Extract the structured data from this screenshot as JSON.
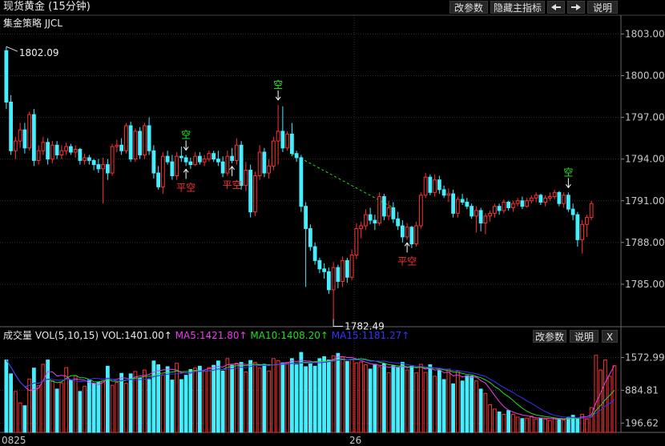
{
  "window": {
    "title": "现货黄金 (15分钟)",
    "strategy": "集金策略 JJCL"
  },
  "toolbar": {
    "params": "改参数",
    "hide_indicator": "隐藏主指标",
    "left_arrow": "left-arrow-icon",
    "right_arrow": "right-arrow-icon",
    "help": "说明"
  },
  "vol_toolbar": {
    "params": "改参数",
    "help": "说明",
    "close": "X"
  },
  "colors": {
    "up": "#ff3030",
    "down": "#44eeff",
    "ma5": "#ee3cee",
    "ma10": "#22dd22",
    "ma15": "#3333ff",
    "sell": "#22ee22",
    "close": "#ff3030"
  },
  "chart_data": [
    {
      "type": "candlestick",
      "title": "现货黄金 (15分钟)",
      "ylim": [
        1782.0,
        1803.6
      ],
      "y_ticks": [
        "1803.00",
        "1800.00",
        "1797.00",
        "1794.00",
        "1791.00",
        "1788.00",
        "1785.00"
      ],
      "x_ticks": [
        {
          "index": 0,
          "label": "0825"
        },
        {
          "index": 76,
          "label": "26"
        }
      ],
      "candles": [
        [
          1801.8,
          1802.09,
          1797.6,
          1798.1
        ],
        [
          1798.1,
          1798.6,
          1794.3,
          1794.6
        ],
        [
          1794.6,
          1795.6,
          1794.0,
          1795.3
        ],
        [
          1795.3,
          1796.6,
          1794.8,
          1796.1
        ],
        [
          1796.1,
          1796.6,
          1794.4,
          1794.8
        ],
        [
          1794.8,
          1797.4,
          1794.6,
          1797.2
        ],
        [
          1797.2,
          1797.6,
          1793.5,
          1793.9
        ],
        [
          1793.9,
          1795.0,
          1793.6,
          1794.6
        ],
        [
          1794.6,
          1795.6,
          1794.3,
          1795.2
        ],
        [
          1795.2,
          1795.5,
          1793.6,
          1794.0
        ],
        [
          1794.0,
          1795.3,
          1793.7,
          1795.0
        ],
        [
          1795.0,
          1795.3,
          1794.0,
          1794.3
        ],
        [
          1794.3,
          1795.0,
          1794.0,
          1794.6
        ],
        [
          1794.6,
          1795.2,
          1794.3,
          1794.9
        ],
        [
          1794.9,
          1795.1,
          1794.3,
          1794.5
        ],
        [
          1794.5,
          1795.0,
          1794.1,
          1794.7
        ],
        [
          1794.7,
          1794.8,
          1793.6,
          1793.9
        ],
        [
          1793.9,
          1794.4,
          1793.6,
          1794.1
        ],
        [
          1794.1,
          1794.3,
          1793.6,
          1793.9
        ],
        [
          1793.9,
          1794.0,
          1793.2,
          1793.6
        ],
        [
          1793.6,
          1794.0,
          1793.0,
          1793.3
        ],
        [
          1793.3,
          1794.1,
          1790.8,
          1793.6
        ],
        [
          1793.6,
          1794.0,
          1792.5,
          1793.0
        ],
        [
          1793.0,
          1795.1,
          1792.8,
          1794.9
        ],
        [
          1794.9,
          1795.4,
          1794.5,
          1795.0
        ],
        [
          1795.0,
          1795.5,
          1794.3,
          1794.6
        ],
        [
          1794.6,
          1796.6,
          1794.4,
          1796.4
        ],
        [
          1796.4,
          1796.7,
          1793.8,
          1794.0
        ],
        [
          1794.0,
          1796.2,
          1793.8,
          1796.0
        ],
        [
          1796.0,
          1796.3,
          1794.0,
          1794.3
        ],
        [
          1794.3,
          1796.6,
          1794.0,
          1796.4
        ],
        [
          1796.4,
          1797.0,
          1794.3,
          1794.6
        ],
        [
          1794.6,
          1795.0,
          1792.6,
          1793.0
        ],
        [
          1793.0,
          1793.5,
          1791.8,
          1792.0
        ],
        [
          1792.0,
          1794.5,
          1791.5,
          1794.2
        ],
        [
          1794.2,
          1794.6,
          1793.6,
          1793.8
        ],
        [
          1793.8,
          1794.3,
          1792.5,
          1792.8
        ],
        [
          1792.8,
          1794.5,
          1792.5,
          1794.2
        ],
        [
          1794.2,
          1794.9,
          1793.8,
          1794.1
        ],
        [
          1794.1,
          1794.3,
          1793.5,
          1793.8
        ],
        [
          1793.8,
          1794.1,
          1793.3,
          1793.6
        ],
        [
          1793.6,
          1794.5,
          1793.5,
          1794.2
        ],
        [
          1794.2,
          1794.5,
          1793.6,
          1793.8
        ],
        [
          1793.8,
          1794.3,
          1793.5,
          1794.0
        ],
        [
          1794.0,
          1794.6,
          1793.8,
          1794.4
        ],
        [
          1794.4,
          1794.6,
          1793.8,
          1794.0
        ],
        [
          1794.0,
          1794.6,
          1793.5,
          1793.8
        ],
        [
          1793.8,
          1794.2,
          1792.7,
          1793.0
        ],
        [
          1793.0,
          1794.6,
          1792.8,
          1794.2
        ],
        [
          1794.2,
          1794.8,
          1793.7,
          1793.9
        ],
        [
          1793.9,
          1795.5,
          1793.6,
          1795.0
        ],
        [
          1795.0,
          1795.3,
          1791.8,
          1792.1
        ],
        [
          1792.1,
          1793.8,
          1791.7,
          1793.2
        ],
        [
          1793.2,
          1793.6,
          1789.8,
          1790.2
        ],
        [
          1790.2,
          1793.1,
          1789.9,
          1792.8
        ],
        [
          1792.8,
          1795.0,
          1792.5,
          1794.5
        ],
        [
          1794.5,
          1794.8,
          1792.7,
          1793.0
        ],
        [
          1793.0,
          1794.0,
          1792.6,
          1793.5
        ],
        [
          1793.5,
          1795.6,
          1793.2,
          1795.3
        ],
        [
          1795.3,
          1797.9,
          1793.6,
          1796.0
        ],
        [
          1796.0,
          1797.8,
          1794.5,
          1794.8
        ],
        [
          1794.8,
          1796.0,
          1794.6,
          1795.8
        ],
        [
          1795.8,
          1796.6,
          1794.2,
          1794.4
        ],
        [
          1794.4,
          1794.6,
          1793.8,
          1794.1
        ],
        [
          1794.1,
          1794.3,
          1790.2,
          1790.6
        ],
        [
          1790.6,
          1790.9,
          1784.8,
          1789.0
        ],
        [
          1789.0,
          1789.3,
          1787.4,
          1787.7
        ],
        [
          1787.7,
          1788.0,
          1786.4,
          1786.7
        ],
        [
          1786.7,
          1786.9,
          1785.8,
          1786.1
        ],
        [
          1786.1,
          1786.5,
          1785.4,
          1785.9
        ],
        [
          1785.9,
          1786.2,
          1784.3,
          1784.6
        ],
        [
          1784.6,
          1786.6,
          1782.49,
          1786.2
        ],
        [
          1786.2,
          1786.4,
          1784.7,
          1785.2
        ],
        [
          1785.2,
          1787.0,
          1784.8,
          1786.7
        ],
        [
          1786.7,
          1786.9,
          1785.1,
          1785.5
        ],
        [
          1785.5,
          1787.5,
          1785.3,
          1787.1
        ],
        [
          1787.1,
          1789.4,
          1786.8,
          1789.0
        ],
        [
          1789.0,
          1789.5,
          1788.3,
          1789.2
        ],
        [
          1789.2,
          1790.4,
          1788.9,
          1790.0
        ],
        [
          1790.0,
          1790.5,
          1789.3,
          1789.6
        ],
        [
          1789.6,
          1790.0,
          1788.9,
          1789.4
        ],
        [
          1789.4,
          1791.6,
          1789.2,
          1791.3
        ],
        [
          1791.3,
          1791.5,
          1789.6,
          1789.9
        ],
        [
          1789.9,
          1791.0,
          1789.6,
          1790.5
        ],
        [
          1790.5,
          1790.9,
          1789.4,
          1789.7
        ],
        [
          1789.7,
          1790.2,
          1788.9,
          1789.2
        ],
        [
          1789.2,
          1789.6,
          1788.0,
          1788.4
        ],
        [
          1788.4,
          1789.4,
          1788.2,
          1789.1
        ],
        [
          1789.1,
          1789.2,
          1787.6,
          1787.9
        ],
        [
          1787.9,
          1789.5,
          1787.7,
          1789.2
        ],
        [
          1789.2,
          1791.6,
          1789.0,
          1791.4
        ],
        [
          1791.4,
          1793.0,
          1791.2,
          1792.7
        ],
        [
          1792.7,
          1792.9,
          1791.4,
          1791.6
        ],
        [
          1791.6,
          1792.9,
          1791.3,
          1792.5
        ],
        [
          1792.5,
          1792.8,
          1791.5,
          1791.8
        ],
        [
          1791.8,
          1792.1,
          1791.2,
          1791.4
        ],
        [
          1791.4,
          1791.9,
          1790.9,
          1791.5
        ],
        [
          1791.5,
          1791.8,
          1789.8,
          1790.1
        ],
        [
          1790.1,
          1791.3,
          1789.8,
          1791.1
        ],
        [
          1791.1,
          1791.5,
          1790.7,
          1790.9
        ],
        [
          1790.9,
          1791.2,
          1790.4,
          1790.6
        ],
        [
          1790.6,
          1790.8,
          1789.7,
          1789.9
        ],
        [
          1789.9,
          1790.6,
          1788.7,
          1790.3
        ],
        [
          1790.3,
          1790.5,
          1788.8,
          1789.4
        ],
        [
          1789.4,
          1790.1,
          1788.6,
          1789.9
        ],
        [
          1789.9,
          1790.3,
          1789.5,
          1790.1
        ],
        [
          1790.1,
          1790.8,
          1789.8,
          1790.6
        ],
        [
          1790.6,
          1790.8,
          1790.0,
          1790.3
        ],
        [
          1790.3,
          1791.1,
          1790.1,
          1790.9
        ],
        [
          1790.9,
          1791.0,
          1790.3,
          1790.5
        ],
        [
          1790.5,
          1791.0,
          1790.2,
          1790.8
        ],
        [
          1790.8,
          1791.2,
          1790.6,
          1791.0
        ],
        [
          1791.0,
          1791.3,
          1790.4,
          1790.6
        ],
        [
          1790.6,
          1791.2,
          1790.5,
          1791.0
        ],
        [
          1791.0,
          1791.4,
          1790.8,
          1791.2
        ],
        [
          1791.2,
          1791.6,
          1790.9,
          1791.4
        ],
        [
          1791.4,
          1791.5,
          1790.7,
          1790.9
        ],
        [
          1790.9,
          1791.4,
          1790.6,
          1791.2
        ],
        [
          1791.2,
          1791.6,
          1791.0,
          1791.3
        ],
        [
          1791.3,
          1791.8,
          1791.1,
          1791.6
        ],
        [
          1791.6,
          1791.7,
          1790.6,
          1790.8
        ],
        [
          1790.8,
          1791.6,
          1790.5,
          1791.4
        ],
        [
          1791.4,
          1791.6,
          1790.2,
          1790.4
        ],
        [
          1790.4,
          1790.8,
          1789.6,
          1790.0
        ],
        [
          1790.0,
          1790.2,
          1787.7,
          1788.2
        ],
        [
          1788.2,
          1789.6,
          1787.2,
          1789.3
        ],
        [
          1789.3,
          1790.0,
          1788.4,
          1789.8
        ],
        [
          1789.8,
          1791.0,
          1789.6,
          1790.8
        ]
      ],
      "labels": [
        {
          "text": "1802.09",
          "kind": "high"
        },
        {
          "text": "1782.49",
          "kind": "low"
        }
      ],
      "signals": [
        {
          "index": 39,
          "text": "空",
          "kind": "sell"
        },
        {
          "index": 59,
          "text": "空",
          "kind": "sell"
        },
        {
          "index": 122,
          "text": "空",
          "kind": "sell"
        },
        {
          "index": 39,
          "text": "平空",
          "kind": "close"
        },
        {
          "index": 49,
          "text": "平空",
          "kind": "close"
        },
        {
          "index": 87,
          "text": "平空",
          "kind": "close"
        }
      ],
      "dashed_line": {
        "from": 62,
        "to": 84
      }
    },
    {
      "type": "bar",
      "title": "成交量 VOL(5,10,15)",
      "ylim": [
        0,
        1850
      ],
      "y_ticks": [
        "1572.99",
        "884.81",
        "196.62"
      ],
      "series": [
        {
          "name": "VOL",
          "last_label": "VOL:1401.00↑"
        },
        {
          "name": "MA5",
          "last_label": "MA5:1421.80↑"
        },
        {
          "name": "MA10",
          "last_label": "MA10:1408.20↑"
        },
        {
          "name": "MA15",
          "last_label": "MA15:1181.27↑"
        }
      ],
      "volumes": [
        1520,
        1230,
        860,
        620,
        560,
        1120,
        1350,
        980,
        1430,
        1520,
        1080,
        910,
        1040,
        1360,
        1100,
        1190,
        860,
        970,
        1110,
        1030,
        1050,
        1080,
        1390,
        990,
        1050,
        1240,
        1030,
        1230,
        1280,
        1140,
        1310,
        1110,
        1500,
        1420,
        1210,
        1380,
        1100,
        1450,
        1110,
        1200,
        1320,
        1350,
        1390,
        1290,
        1360,
        1410,
        1500,
        1290,
        1550,
        1410,
        1450,
        1470,
        1270,
        1510,
        1470,
        1350,
        1430,
        1290,
        1550,
        1510,
        1460,
        1470,
        1550,
        1420,
        1680,
        1380,
        1450,
        1390,
        1550,
        1590,
        1520,
        1610,
        1660,
        1580,
        1490,
        1530,
        1460,
        1480,
        1420,
        1330,
        1430,
        1380,
        1440,
        1250,
        1400,
        1360,
        1470,
        1310,
        1390,
        1250,
        1430,
        1260,
        1420,
        1180,
        1300,
        1110,
        1330,
        1020,
        1290,
        1080,
        1190,
        1180,
        1080,
        910,
        820,
        580,
        490,
        430,
        380,
        460,
        380,
        320,
        290,
        300,
        340,
        280,
        300,
        280,
        250,
        300,
        280,
        260,
        320,
        360,
        300,
        380,
        280,
        520,
        1620,
        1310,
        1520,
        1180,
        1401
      ]
    }
  ]
}
